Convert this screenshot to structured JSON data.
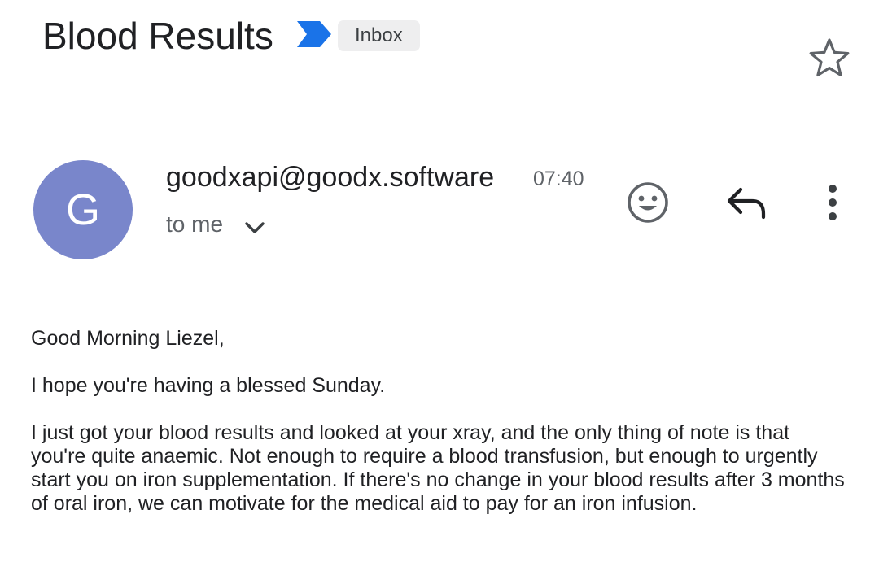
{
  "header": {
    "subject": "Blood Results",
    "label": "Inbox",
    "importance_icon": "importance-marker-icon",
    "star_icon": "star-outline-icon"
  },
  "sender": {
    "avatar_letter": "G",
    "avatar_color": "#7986cb",
    "email": "goodxapi@goodx.software",
    "time": "07:40",
    "recipients": "to me",
    "expand_icon": "chevron-down-icon"
  },
  "actions": {
    "emoji_icon": "emoji-reaction-icon",
    "reply_icon": "reply-icon",
    "more_icon": "more-vert-icon"
  },
  "message": {
    "greeting": "Good Morning Liezel,",
    "line1": "I hope you're having a blessed Sunday.",
    "line2": "I just got your blood results and looked at your xray, and the only thing of note is that you're quite anaemic. Not enough to require a blood transfusion, but enough to urgently start you on iron supplementation. If there's no change in your blood results after 3 months of oral iron, we can motivate for the medical aid to pay for an iron infusion."
  },
  "colors": {
    "accent_blue": "#1a73e8",
    "chip_bg": "#eeeeef",
    "icon_gray": "#5f6368"
  }
}
